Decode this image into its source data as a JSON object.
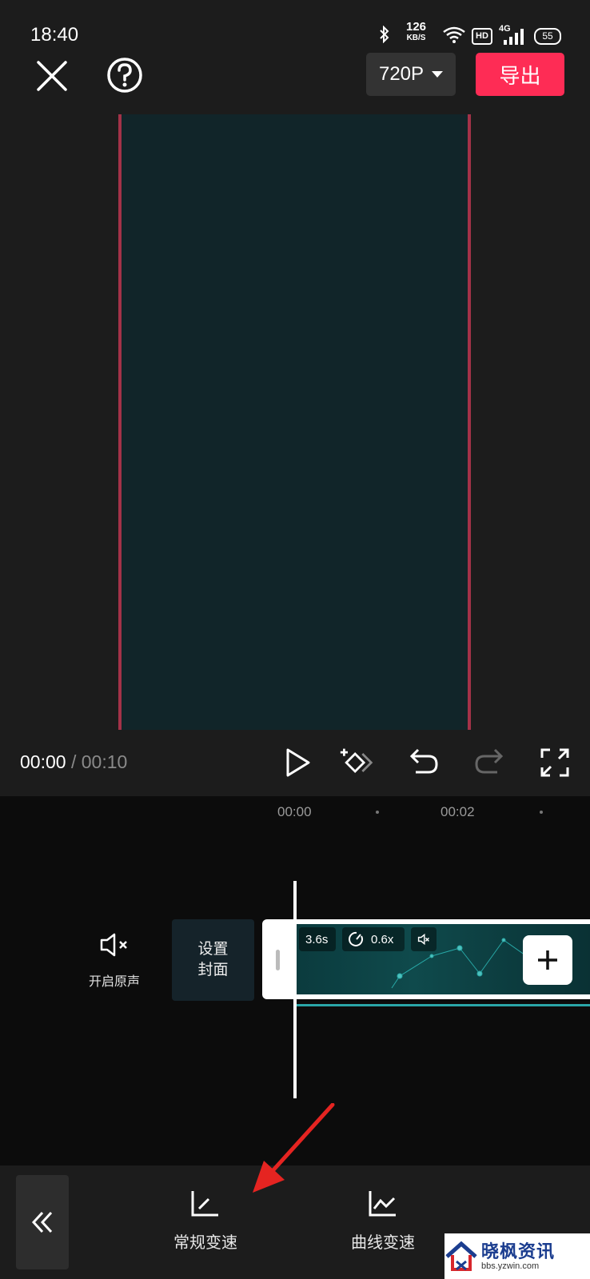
{
  "status_bar": {
    "time": "18:40",
    "net_speed_value": "126",
    "net_speed_unit": "KB/S",
    "hd": "HD",
    "network": "4G",
    "battery": "55"
  },
  "top_bar": {
    "resolution": "720P",
    "export_label": "导出"
  },
  "player": {
    "current_time": "00:00",
    "separator": " / ",
    "total_time": "00:10"
  },
  "timeline": {
    "ruler_marks": [
      "00:00",
      "00:02"
    ],
    "mute_label": "开启原声",
    "cover_label_line1": "设置",
    "cover_label_line2": "封面",
    "clip_duration": "3.6s",
    "clip_speed": "0.6x"
  },
  "toolbar": {
    "tools": [
      "常规变速",
      "曲线变速"
    ]
  },
  "watermark": {
    "title": "晓枫资讯",
    "url": "bbs.yzwin.com"
  },
  "colors": {
    "accent_export": "#fe2c55",
    "preview_border": "#a33248",
    "clip_underline": "#2aa6a8",
    "annotation_arrow": "#e52421"
  }
}
